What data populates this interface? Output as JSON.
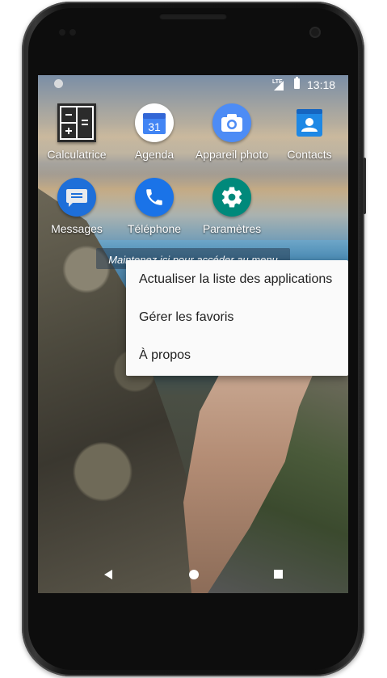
{
  "status_bar": {
    "network_type": "LTE",
    "time": "13:18"
  },
  "apps": [
    {
      "label": "Calculatrice",
      "icon": "calculator-icon",
      "color": "#2b2b2b"
    },
    {
      "label": "Agenda",
      "icon": "calendar-icon",
      "color": "#4285f4",
      "day": "31"
    },
    {
      "label": "Appareil photo",
      "icon": "camera-icon",
      "color": "#4d8cf5"
    },
    {
      "label": "Contacts",
      "icon": "contacts-icon",
      "color": "#1e88e5"
    },
    {
      "label": "Messages",
      "icon": "messages-icon",
      "color": "#1e6fd9"
    },
    {
      "label": "Téléphone",
      "icon": "phone-icon",
      "color": "#1a73e8"
    },
    {
      "label": "Paramètres",
      "icon": "settings-icon",
      "color": "#00897b"
    }
  ],
  "hint_text": "Maintenez ici pour accéder au menu",
  "context_menu": {
    "items": [
      "Actualiser la liste des applications",
      "Gérer les favoris",
      "À propos"
    ]
  },
  "nav_bar": {
    "back_icon": "back-icon",
    "home_icon": "home-icon",
    "recents_icon": "recents-icon"
  }
}
